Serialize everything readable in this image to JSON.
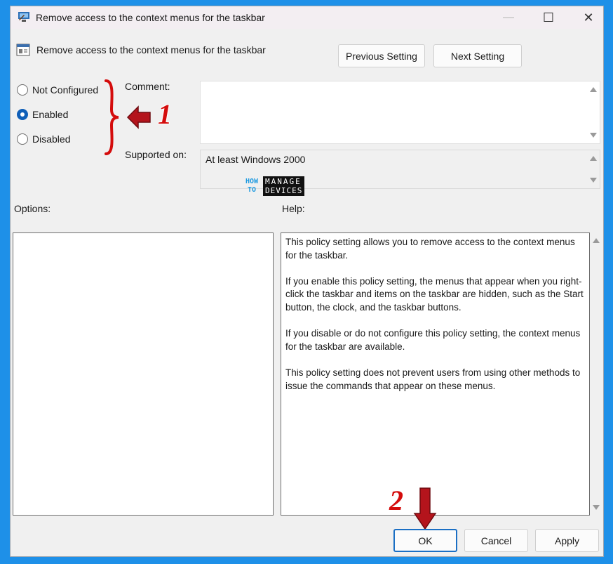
{
  "window": {
    "title": "Remove access to the context menus for the taskbar",
    "controls": {
      "minimize": "—",
      "maximize": "☐",
      "close": "✕"
    }
  },
  "header": {
    "policy_name": "Remove access to the context menus for the taskbar",
    "previous_label": "Previous Setting",
    "next_label": "Next Setting"
  },
  "state": {
    "options": [
      {
        "label": "Not Configured",
        "selected": false
      },
      {
        "label": "Enabled",
        "selected": true
      },
      {
        "label": "Disabled",
        "selected": false
      }
    ]
  },
  "comment": {
    "label": "Comment:",
    "value": ""
  },
  "supported": {
    "label": "Supported on:",
    "value": "At least Windows 2000"
  },
  "options_pane": {
    "label": "Options:"
  },
  "help_pane": {
    "label": "Help:",
    "paragraphs": [
      "This policy setting allows you to remove access to the context menus for the taskbar.",
      "If you enable this policy setting, the menus that appear when you right-click the taskbar and items on the taskbar are hidden, such as the Start button, the clock, and the taskbar buttons.",
      "If you disable or do not configure this policy setting, the context menus for the taskbar are available.",
      "This policy setting does not prevent users from using other methods to issue the commands that appear on these menus."
    ]
  },
  "footer": {
    "ok_label": "OK",
    "cancel_label": "Cancel",
    "apply_label": "Apply"
  },
  "annotations": {
    "marker_1": "1",
    "marker_2": "2",
    "accent": "#d40c0c"
  },
  "watermark": {
    "how": "HOW",
    "to": "TO",
    "manage": "MANAGE",
    "devices": "DEVICES"
  },
  "colors": {
    "background": "#1e90e8",
    "selected_radio": "#0f5fb8",
    "ok_border": "#1b6fc4"
  }
}
